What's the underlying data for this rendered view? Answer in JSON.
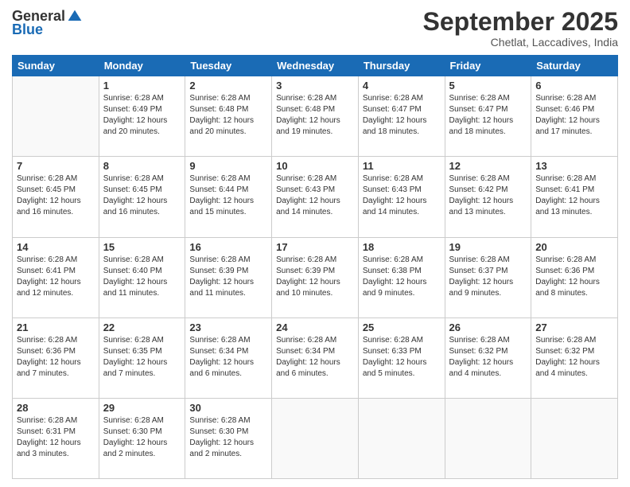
{
  "logo": {
    "general": "General",
    "blue": "Blue"
  },
  "header": {
    "month": "September 2025",
    "location": "Chetlat, Laccadives, India"
  },
  "weekdays": [
    "Sunday",
    "Monday",
    "Tuesday",
    "Wednesday",
    "Thursday",
    "Friday",
    "Saturday"
  ],
  "weeks": [
    [
      {
        "day": "",
        "info": ""
      },
      {
        "day": "1",
        "info": "Sunrise: 6:28 AM\nSunset: 6:49 PM\nDaylight: 12 hours\nand 20 minutes."
      },
      {
        "day": "2",
        "info": "Sunrise: 6:28 AM\nSunset: 6:48 PM\nDaylight: 12 hours\nand 20 minutes."
      },
      {
        "day": "3",
        "info": "Sunrise: 6:28 AM\nSunset: 6:48 PM\nDaylight: 12 hours\nand 19 minutes."
      },
      {
        "day": "4",
        "info": "Sunrise: 6:28 AM\nSunset: 6:47 PM\nDaylight: 12 hours\nand 18 minutes."
      },
      {
        "day": "5",
        "info": "Sunrise: 6:28 AM\nSunset: 6:47 PM\nDaylight: 12 hours\nand 18 minutes."
      },
      {
        "day": "6",
        "info": "Sunrise: 6:28 AM\nSunset: 6:46 PM\nDaylight: 12 hours\nand 17 minutes."
      }
    ],
    [
      {
        "day": "7",
        "info": "Sunrise: 6:28 AM\nSunset: 6:45 PM\nDaylight: 12 hours\nand 16 minutes."
      },
      {
        "day": "8",
        "info": "Sunrise: 6:28 AM\nSunset: 6:45 PM\nDaylight: 12 hours\nand 16 minutes."
      },
      {
        "day": "9",
        "info": "Sunrise: 6:28 AM\nSunset: 6:44 PM\nDaylight: 12 hours\nand 15 minutes."
      },
      {
        "day": "10",
        "info": "Sunrise: 6:28 AM\nSunset: 6:43 PM\nDaylight: 12 hours\nand 14 minutes."
      },
      {
        "day": "11",
        "info": "Sunrise: 6:28 AM\nSunset: 6:43 PM\nDaylight: 12 hours\nand 14 minutes."
      },
      {
        "day": "12",
        "info": "Sunrise: 6:28 AM\nSunset: 6:42 PM\nDaylight: 12 hours\nand 13 minutes."
      },
      {
        "day": "13",
        "info": "Sunrise: 6:28 AM\nSunset: 6:41 PM\nDaylight: 12 hours\nand 13 minutes."
      }
    ],
    [
      {
        "day": "14",
        "info": "Sunrise: 6:28 AM\nSunset: 6:41 PM\nDaylight: 12 hours\nand 12 minutes."
      },
      {
        "day": "15",
        "info": "Sunrise: 6:28 AM\nSunset: 6:40 PM\nDaylight: 12 hours\nand 11 minutes."
      },
      {
        "day": "16",
        "info": "Sunrise: 6:28 AM\nSunset: 6:39 PM\nDaylight: 12 hours\nand 11 minutes."
      },
      {
        "day": "17",
        "info": "Sunrise: 6:28 AM\nSunset: 6:39 PM\nDaylight: 12 hours\nand 10 minutes."
      },
      {
        "day": "18",
        "info": "Sunrise: 6:28 AM\nSunset: 6:38 PM\nDaylight: 12 hours\nand 9 minutes."
      },
      {
        "day": "19",
        "info": "Sunrise: 6:28 AM\nSunset: 6:37 PM\nDaylight: 12 hours\nand 9 minutes."
      },
      {
        "day": "20",
        "info": "Sunrise: 6:28 AM\nSunset: 6:36 PM\nDaylight: 12 hours\nand 8 minutes."
      }
    ],
    [
      {
        "day": "21",
        "info": "Sunrise: 6:28 AM\nSunset: 6:36 PM\nDaylight: 12 hours\nand 7 minutes."
      },
      {
        "day": "22",
        "info": "Sunrise: 6:28 AM\nSunset: 6:35 PM\nDaylight: 12 hours\nand 7 minutes."
      },
      {
        "day": "23",
        "info": "Sunrise: 6:28 AM\nSunset: 6:34 PM\nDaylight: 12 hours\nand 6 minutes."
      },
      {
        "day": "24",
        "info": "Sunrise: 6:28 AM\nSunset: 6:34 PM\nDaylight: 12 hours\nand 6 minutes."
      },
      {
        "day": "25",
        "info": "Sunrise: 6:28 AM\nSunset: 6:33 PM\nDaylight: 12 hours\nand 5 minutes."
      },
      {
        "day": "26",
        "info": "Sunrise: 6:28 AM\nSunset: 6:32 PM\nDaylight: 12 hours\nand 4 minutes."
      },
      {
        "day": "27",
        "info": "Sunrise: 6:28 AM\nSunset: 6:32 PM\nDaylight: 12 hours\nand 4 minutes."
      }
    ],
    [
      {
        "day": "28",
        "info": "Sunrise: 6:28 AM\nSunset: 6:31 PM\nDaylight: 12 hours\nand 3 minutes."
      },
      {
        "day": "29",
        "info": "Sunrise: 6:28 AM\nSunset: 6:30 PM\nDaylight: 12 hours\nand 2 minutes."
      },
      {
        "day": "30",
        "info": "Sunrise: 6:28 AM\nSunset: 6:30 PM\nDaylight: 12 hours\nand 2 minutes."
      },
      {
        "day": "",
        "info": ""
      },
      {
        "day": "",
        "info": ""
      },
      {
        "day": "",
        "info": ""
      },
      {
        "day": "",
        "info": ""
      }
    ]
  ]
}
